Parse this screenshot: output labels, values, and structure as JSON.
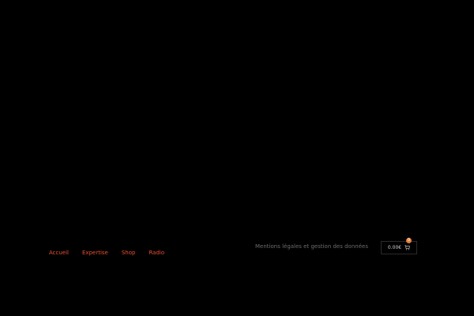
{
  "footer": {
    "nav": [
      {
        "label": "Accueil"
      },
      {
        "label": "Expertise"
      },
      {
        "label": "Shop"
      },
      {
        "label": "Radio"
      }
    ],
    "legal_link": "Mentions légales et gestion des données"
  },
  "cart": {
    "amount": "0.00€",
    "count": "0",
    "icon": "cart-icon"
  },
  "colors": {
    "background": "#000000",
    "accent": "#e8502f",
    "badge": "#e8803a",
    "muted_text": "#6b6b6b"
  }
}
